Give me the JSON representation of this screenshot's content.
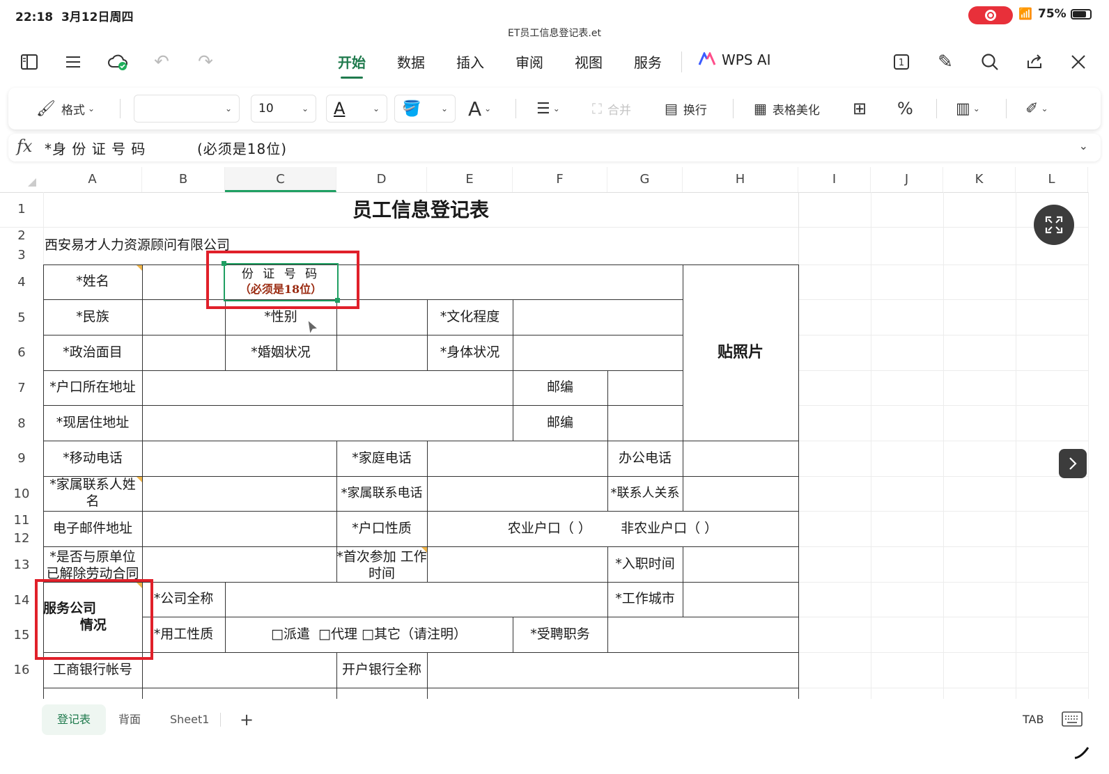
{
  "status": {
    "time": "22:18",
    "date": "3月12日周四",
    "battery": "75%"
  },
  "file": {
    "name": "ET员工信息登记表.et"
  },
  "tabs": [
    {
      "label": "开始",
      "active": true
    },
    {
      "label": "数据"
    },
    {
      "label": "插入"
    },
    {
      "label": "审阅"
    },
    {
      "label": "视图"
    },
    {
      "label": "服务"
    },
    {
      "label": "WPS AI"
    }
  ],
  "ribbon": {
    "format_label": "格式",
    "font_name": "",
    "font_size": "10",
    "merge_label": "合并",
    "wrap_label": "换行",
    "beautify_label": "表格美化"
  },
  "formula": {
    "fx": "fx",
    "content": "*身 份 证 号 码          (必须是18位)"
  },
  "columns": [
    "A",
    "B",
    "C",
    "D",
    "E",
    "F",
    "G",
    "H",
    "I",
    "J",
    "K",
    "L"
  ],
  "rows": [
    "1",
    "2",
    "3",
    "4",
    "5",
    "6",
    "7",
    "8",
    "9",
    "10",
    "11",
    "12",
    "13",
    "14",
    "15",
    "16"
  ],
  "sheet": {
    "title": "员工信息登记表",
    "company": "西安易才人力资源顾问有限公司",
    "cells": {
      "name": "*姓名",
      "id_line1": "份 证 号 码",
      "id_line2": "（必须是18位）",
      "ethnic": "*民族",
      "gender": "*性别",
      "education": "*文化程度",
      "politics": "*政治面目",
      "marital": "*婚姻状况",
      "health": "*身体状况",
      "photo": "贴照片",
      "hukou_addr": "*户口所在地址",
      "postcode1": "邮编",
      "current_addr": "*现居住地址",
      "postcode2": "邮编",
      "mobile": "*移动电话",
      "home_phone": "*家庭电话",
      "office_phone": "办公电话",
      "family_name": "*家属联系人姓名",
      "family_phone": "*家属联系电话",
      "relation": "*联系人关系",
      "email": "电子邮件地址",
      "hukou_type": "*户口性质",
      "hukou_options": "农业户口（ ）       非农业户口（ ）",
      "contract": "*是否与原单位已解除劳动合同",
      "first_work": "*首次参加  工作时间",
      "hire_date": "*入职时间",
      "service_co": "服务公司\n        情况",
      "co_fullname": "*公司全称",
      "work_city": "*工作城市",
      "employ_type": "*用工性质",
      "employ_options": "□派遣  □代理 □其它（请注明）",
      "position": "*受聘职务",
      "bank_account": "工商银行帐号",
      "bank_name": "开户银行全称"
    }
  },
  "sheet_tabs": [
    {
      "label": "登记表",
      "active": true
    },
    {
      "label": "背面"
    },
    {
      "label": "Sheet1"
    }
  ],
  "bottom": {
    "tab_label": "TAB"
  }
}
